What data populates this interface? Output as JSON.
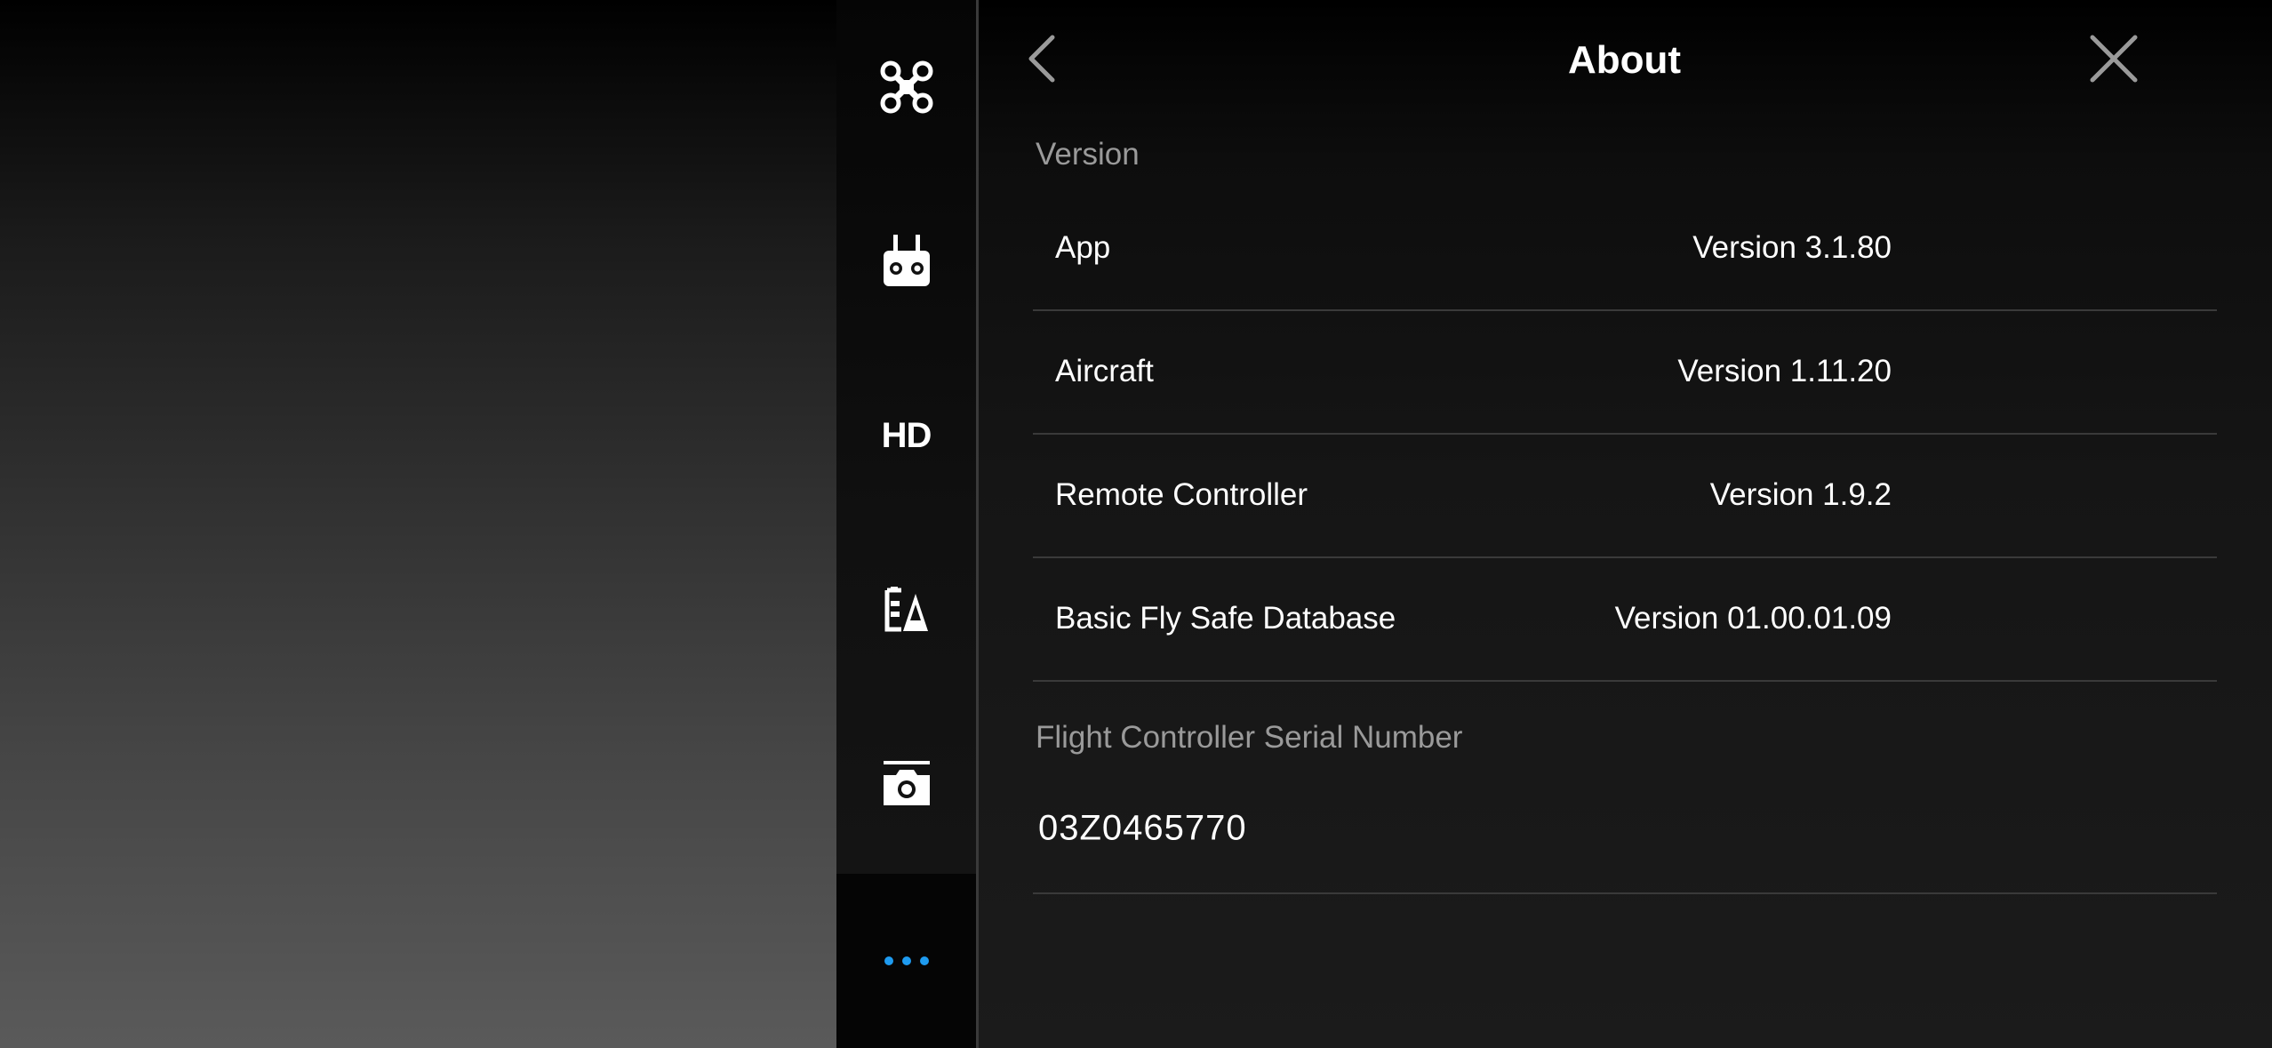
{
  "header": {
    "title": "About"
  },
  "sidebar": {
    "items": [
      {
        "name": "aircraft-icon",
        "label": ""
      },
      {
        "name": "remote-controller-icon",
        "label": ""
      },
      {
        "name": "hd-icon",
        "label": "HD"
      },
      {
        "name": "battery-icon",
        "label": ""
      },
      {
        "name": "camera-icon",
        "label": ""
      },
      {
        "name": "more-icon",
        "label": ""
      }
    ],
    "active_color": "#1e9bf0"
  },
  "version_section": {
    "label": "Version",
    "rows": [
      {
        "label": "App",
        "value": "Version 3.1.80"
      },
      {
        "label": "Aircraft",
        "value": "Version 1.11.20"
      },
      {
        "label": "Remote Controller",
        "value": "Version 1.9.2"
      },
      {
        "label": "Basic Fly Safe Database",
        "value": "Version 01.00.01.09"
      }
    ]
  },
  "serial_section": {
    "label": "Flight Controller Serial Number",
    "value": "03Z0465770"
  }
}
